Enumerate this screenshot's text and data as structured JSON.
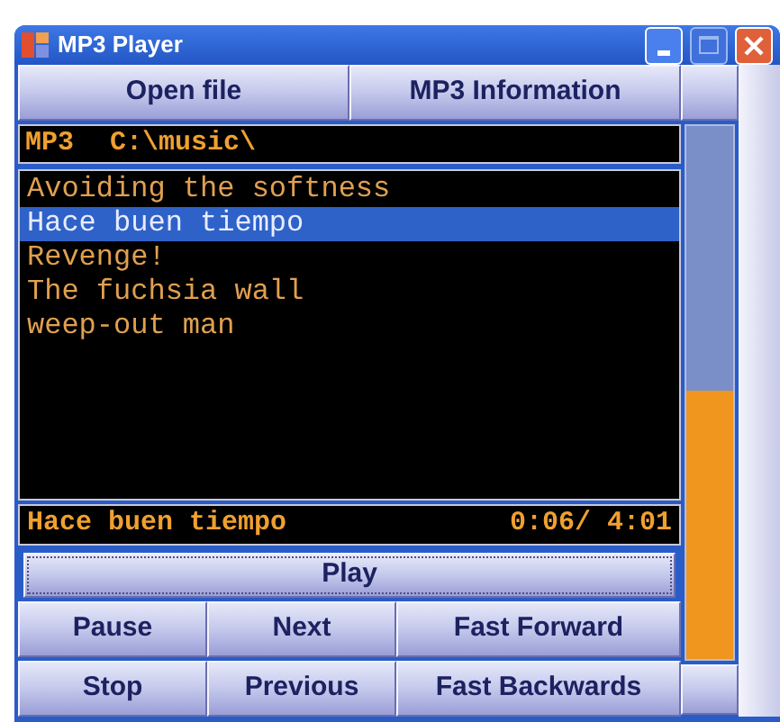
{
  "window": {
    "title": "MP3 Player"
  },
  "top_buttons": [
    "Open file",
    "MP3 Information"
  ],
  "path_bar": {
    "label": "MP3",
    "path": "C:\\music\\"
  },
  "playlist": [
    {
      "title": "Avoiding the softness",
      "selected": false
    },
    {
      "title": "Hace buen tiempo",
      "selected": true
    },
    {
      "title": "Revenge!",
      "selected": false
    },
    {
      "title": "The fuchsia wall",
      "selected": false
    },
    {
      "title": "weep-out man",
      "selected": false
    }
  ],
  "now_playing": {
    "title": "Hace buen tiempo",
    "time": "0:06/ 4:01"
  },
  "meter": {
    "level": 0.5
  },
  "play_button": "Play",
  "control_buttons": [
    [
      "Pause",
      "Next",
      "Fast Forward"
    ],
    [
      "Stop",
      "Previous",
      "Fast Backwards"
    ]
  ]
}
